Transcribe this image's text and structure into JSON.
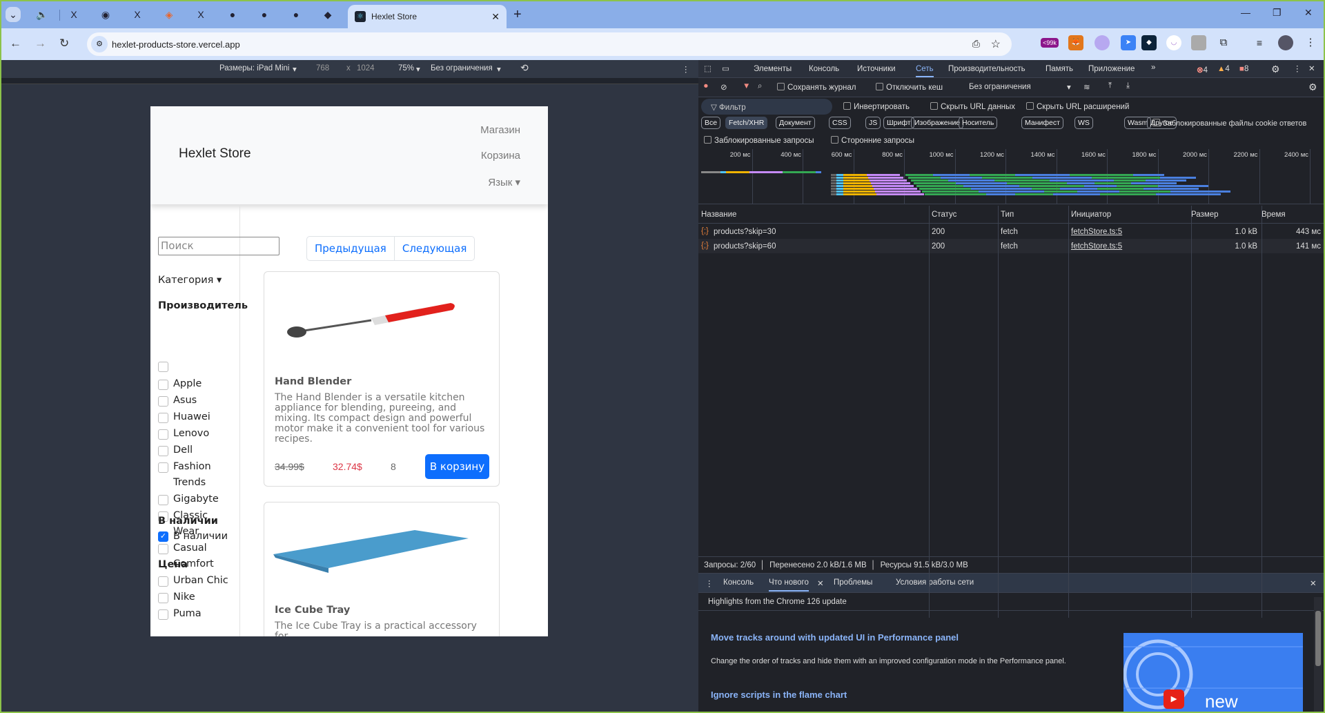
{
  "browser": {
    "tabs": [
      {
        "icon": "speaker-icon"
      },
      {
        "icon": "x-icon"
      },
      {
        "icon": "app-icon"
      },
      {
        "icon": "x-icon"
      },
      {
        "icon": "diamond-icon"
      },
      {
        "icon": "x-icon"
      },
      {
        "icon": "github-icon"
      },
      {
        "icon": "github-icon"
      },
      {
        "icon": "github-icon"
      },
      {
        "icon": "app-icon"
      }
    ],
    "active_tab": "Hexlet Store",
    "url": "hexlet-products-store.vercel.app",
    "ext_badge": "<99k"
  },
  "device_toolbar": {
    "dimensions": "Размеры: iPad Mini",
    "width": "768",
    "times": "x",
    "height": "1024",
    "zoom": "75%",
    "throttle": "Без ограничения"
  },
  "store": {
    "brand": "Hexlet Store",
    "nav": [
      "Магазин",
      "Корзина",
      "Язык"
    ],
    "search_placeholder": "Поиск",
    "category": "Категория",
    "maker_title": "Производитель",
    "makers": [
      "",
      "Apple",
      "Asus",
      "Huawei",
      "Lenovo",
      "Dell",
      "Fashion Trends",
      "Gigabyte",
      "Classic Wear",
      "Casual Comfort",
      "Urban Chic",
      "Nike",
      "Puma"
    ],
    "stock_title": "В наличии",
    "stock_label": "В наличии",
    "price_title": "Цена",
    "prev": "Предыдущая",
    "next": "Следующая",
    "products": [
      {
        "title": "Hand Blender",
        "desc": "The Hand Blender is a versatile kitchen appliance for blending, pureeing, and mixing. Its compact design and powerful motor make it a convenient tool for various recipes.",
        "old_price": "34.99$",
        "price": "32.74$",
        "qty": "8",
        "cart": "В корзину"
      },
      {
        "title": "Ice Cube Tray",
        "desc": "The Ice Cube Tray is a practical accessory for"
      }
    ]
  },
  "devtools": {
    "tabs": [
      "Элементы",
      "Консоль",
      "Источники",
      "Сеть",
      "Производительность",
      "Память",
      "Приложение"
    ],
    "counts": {
      "errors": "4",
      "warnings": "4",
      "issues": "8"
    },
    "preserve_log": "Сохранять журнал",
    "disable_cache": "Отключить кеш",
    "throttle": "Без ограничения",
    "filter_placeholder": "Фильтр",
    "invert": "Инвертировать",
    "hide_data": "Скрыть URL данных",
    "hide_ext": "Скрыть URL расширений",
    "types": [
      "Все",
      "Fetch/XHR",
      "Документ",
      "CSS",
      "JS",
      "Шрифт",
      "Изображение",
      "Носитель",
      "Манифест",
      "WS",
      "Wasm",
      "Другое"
    ],
    "blocked_cookies": "Заблокированные файлы cookie ответов",
    "blocked_requests": "Заблокированные запросы",
    "third_party": "Сторонние запросы",
    "ticks": [
      "200 мс",
      "400 мс",
      "600 мс",
      "800 мс",
      "1000 мс",
      "1200 мс",
      "1400 мс",
      "1600 мс",
      "1800 мс",
      "2000 мс",
      "2200 мс",
      "2400 мс"
    ],
    "columns": [
      "Название",
      "Статус",
      "Тип",
      "Инициатор",
      "Размер",
      "Время"
    ],
    "rows": [
      {
        "name": "products?skip=30",
        "status": "200",
        "type": "fetch",
        "initiator": "fetchStore.ts:5",
        "size": "1.0 kB",
        "time": "443 мс"
      },
      {
        "name": "products?skip=60",
        "status": "200",
        "type": "fetch",
        "initiator": "fetchStore.ts:5",
        "size": "1.0 kB",
        "time": "141 мс"
      }
    ],
    "status": [
      "Запросы: 2/60",
      "Перенесено 2.0 kB/1.6 MB",
      "Ресурсы 91.5 kB/3.0 MB"
    ],
    "drawer_tabs": [
      "Консоль",
      "Что нового",
      "Проблемы",
      "Условия работы сети"
    ],
    "whatsnew": {
      "header": "Highlights from the Chrome 126 update",
      "h1": "Move tracks around with updated UI in Performance panel",
      "p1": "Change the order of tracks and hide them with an improved configuration mode in the Performance panel.",
      "h2": "Ignore scripts in the flame chart",
      "video_label": "new"
    }
  }
}
